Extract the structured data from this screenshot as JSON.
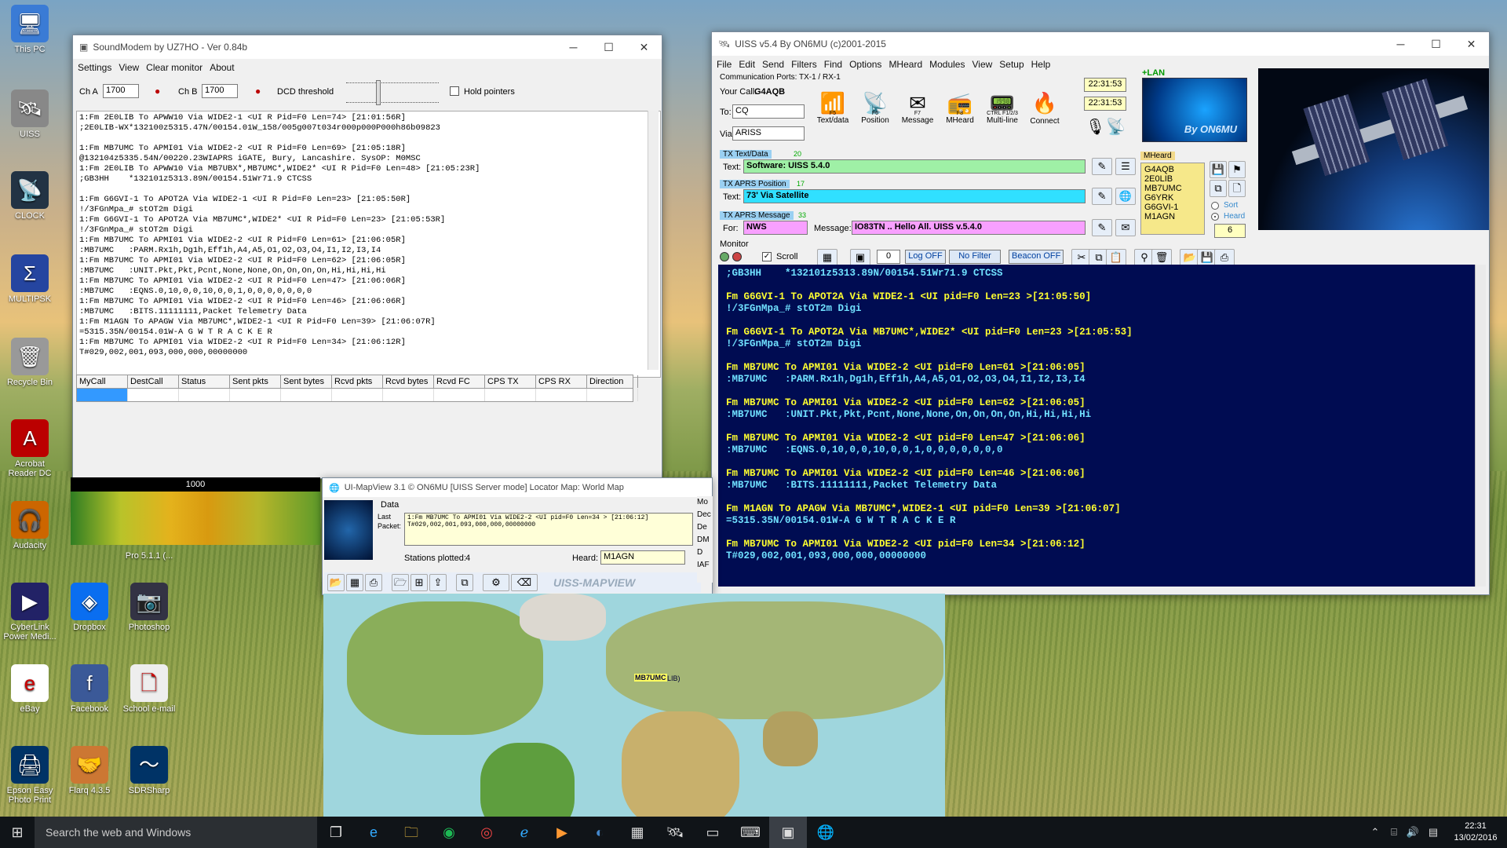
{
  "desktop": {
    "icons": [
      {
        "label": "This PC",
        "glyph": "🖥"
      },
      {
        "label": "UISS",
        "glyph": "🛰"
      },
      {
        "label": "CLOCK",
        "glyph": "📡"
      },
      {
        "label": "MULTIPSK",
        "glyph": "Σ"
      },
      {
        "label": "Recycle Bin",
        "glyph": "🗑"
      },
      {
        "label": "Acrobat Reader DC",
        "glyph": "A"
      },
      {
        "label": "Audacity",
        "glyph": "🎧"
      },
      {
        "label": "CyberLink Power Medi...",
        "glyph": "▶"
      },
      {
        "label": "Dropbox",
        "glyph": "◈"
      },
      {
        "label": "Photoshop",
        "glyph": "📷"
      },
      {
        "label": "eBay",
        "glyph": "e"
      },
      {
        "label": "Facebook",
        "glyph": "f"
      },
      {
        "label": "School e-mail",
        "glyph": "🗋"
      },
      {
        "label": "Epson Easy Photo Print",
        "glyph": "🖨"
      },
      {
        "label": "Flarq 4.3.5",
        "glyph": "🤝"
      },
      {
        "label": "SDRSharp",
        "glyph": "〜"
      },
      {
        "label": "Pro 5.1.1 (...",
        "glyph": ""
      }
    ]
  },
  "soundmodem": {
    "title": "SoundModem by UZ7HO - Ver 0.84b",
    "menu": [
      "Settings",
      "View",
      "Clear monitor",
      "About"
    ],
    "cha_label": "Ch A",
    "cha_value": "1700",
    "chb_label": "Ch B",
    "chb_value": "1700",
    "dcd_label": "DCD threshold",
    "hold_label": "Hold pointers",
    "lines": [
      "1:Fm 2E0LIB To APWW10 Via WIDE2-1 <UI R Pid=F0 Len=74> [21:01:56R]",
      ";2E0LIB-WX*132100z5315.47N/00154.01W_158/005g007t034r000p000P000h86b09823",
      "",
      "1:Fm MB7UMC To APMI01 Via WIDE2-2 <UI R Pid=F0 Len=69> [21:05:18R]",
      "@132104z5335.54N/00220.23WIAPRS iGATE, Bury, Lancashire. SysOP: M0MSC",
      "1:Fm 2E0LIB To APWW10 Via MB7UBX*,MB7UMC*,WIDE2* <UI R Pid=F0 Len=48> [21:05:23R]",
      ";GB3HH    *132101z5313.89N/00154.51Wr71.9 CTCSS",
      "",
      "1:Fm G6GVI-1 To APOT2A Via WIDE2-1 <UI R Pid=F0 Len=23> [21:05:50R]",
      "!/3FGnMpa_# stOT2m Digi",
      "1:Fm G6GVI-1 To APOT2A Via MB7UMC*,WIDE2* <UI R Pid=F0 Len=23> [21:05:53R]",
      "!/3FGnMpa_# stOT2m Digi",
      "1:Fm MB7UMC To APMI01 Via WIDE2-2 <UI R Pid=F0 Len=61> [21:06:05R]",
      ":MB7UMC   :PARM.Rx1h,Dg1h,Eff1h,A4,A5,O1,O2,O3,O4,I1,I2,I3,I4",
      "1:Fm MB7UMC To APMI01 Via WIDE2-2 <UI R Pid=F0 Len=62> [21:06:05R]",
      ":MB7UMC   :UNIT.Pkt,Pkt,Pcnt,None,None,On,On,On,On,Hi,Hi,Hi,Hi",
      "1:Fm MB7UMC To APMI01 Via WIDE2-2 <UI R Pid=F0 Len=47> [21:06:06R]",
      ":MB7UMC   :EQNS.0,10,0,0,10,0,0,1,0,0,0,0,0,0,0",
      "1:Fm MB7UMC To APMI01 Via WIDE2-2 <UI R Pid=F0 Len=46> [21:06:06R]",
      ":MB7UMC   :BITS.11111111,Packet Telemetry Data",
      "1:Fm M1AGN To APAGW Via MB7UMC*,WIDE2-1 <UI R Pid=F0 Len=39> [21:06:07R]",
      "=5315.35N/00154.01W-A G W T R A C K E R",
      "1:Fm MB7UMC To APMI01 Via WIDE2-2 <UI R Pid=F0 Len=34> [21:06:12R]",
      "T#029,002,001,093,000,000,00000000"
    ],
    "columns": [
      "MyCall",
      "DestCall",
      "Status",
      "Sent pkts",
      "Sent bytes",
      "Rcvd pkts",
      "Rcvd bytes",
      "Rcvd FC",
      "CPS TX",
      "CPS RX",
      "Direction"
    ],
    "waterfall_label": "1000"
  },
  "uiss": {
    "title": "UISS v5.4 By ON6MU (c)2001-2015",
    "menu": [
      "File",
      "Edit",
      "Send",
      "Filters",
      "Find",
      "Options",
      "MHeard",
      "Modules",
      "View",
      "Setup",
      "Help"
    ],
    "comm_ports": "Communication Ports: TX-1 / RX-1",
    "your_call_label": "Your Call:",
    "your_call": "G4AQB",
    "to_label": "To:",
    "to_value": "CQ",
    "via_label": "Via:",
    "via_value": "ARISS",
    "buttons": [
      {
        "key": "F5",
        "label": "Text/data"
      },
      {
        "key": "F6",
        "label": "Position"
      },
      {
        "key": "F7",
        "label": "Message"
      },
      {
        "key": "F8",
        "label": "MHeard"
      },
      {
        "key": "CTRL F1/2/3",
        "label": "Multi-line"
      },
      {
        "key": "",
        "label": "Connect"
      }
    ],
    "clock1": "22:31:53",
    "clock2": "22:31:53",
    "lan": "+LAN",
    "logo": "By ON6MU",
    "tx_text_hdr": "TX Text/Data",
    "tx_text_num": "20",
    "text_label": "Text:",
    "text_value": "Software: UISS 5.4.0",
    "tx_pos_hdr": "TX APRS Position",
    "tx_pos_num": "17",
    "pos_value": "73' Via Satellite",
    "tx_msg_hdr": "TX APRS Message",
    "tx_msg_num": "33",
    "for_label": "For:",
    "for_value": "NWS",
    "msg_label": "Message:",
    "msg_value": "IO83TN .. Hello All. UISS v.5.4.0",
    "mheard_hdr": "MHeard",
    "mheard": [
      "G4AQB",
      "2E0LIB",
      "MB7UMC",
      "G6YRK",
      "G6GVI-1",
      "M1AGN"
    ],
    "sort_label": "Sort",
    "heard_label": "Heard",
    "mheard_count": "6",
    "monitor_label": "Monitor",
    "scroll_label": "Scroll",
    "counter": "0",
    "log_btn": "Log OFF",
    "filter_btn": "No Filter",
    "beacon_btn": "Beacon OFF",
    "monitor_lines": [
      {
        "t": ";GB3HH    *132101z5313.89N/00154.51Wr71.9 CTCSS",
        "c": "c"
      },
      {
        "t": "",
        "c": "y"
      },
      {
        "t": "Fm G6GVI-1 To APOT2A Via WIDE2-1 <UI pid=F0 Len=23 >[21:05:50]",
        "c": "y"
      },
      {
        "t": "!/3FGnMpa_# stOT2m Digi",
        "c": "c"
      },
      {
        "t": "",
        "c": "y"
      },
      {
        "t": "Fm G6GVI-1 To APOT2A Via MB7UMC*,WIDE2* <UI pid=F0 Len=23 >[21:05:53]",
        "c": "y"
      },
      {
        "t": "!/3FGnMpa_# stOT2m Digi",
        "c": "c"
      },
      {
        "t": "",
        "c": "y"
      },
      {
        "t": "Fm MB7UMC To APMI01 Via WIDE2-2 <UI pid=F0 Len=61 >[21:06:05]",
        "c": "y"
      },
      {
        "t": ":MB7UMC   :PARM.Rx1h,Dg1h,Eff1h,A4,A5,O1,O2,O3,O4,I1,I2,I3,I4",
        "c": "c"
      },
      {
        "t": "",
        "c": "y"
      },
      {
        "t": "Fm MB7UMC To APMI01 Via WIDE2-2 <UI pid=F0 Len=62 >[21:06:05]",
        "c": "y"
      },
      {
        "t": ":MB7UMC   :UNIT.Pkt,Pkt,Pcnt,None,None,On,On,On,On,Hi,Hi,Hi,Hi",
        "c": "c"
      },
      {
        "t": "",
        "c": "y"
      },
      {
        "t": "Fm MB7UMC To APMI01 Via WIDE2-2 <UI pid=F0 Len=47 >[21:06:06]",
        "c": "y"
      },
      {
        "t": ":MB7UMC   :EQNS.0,10,0,0,10,0,0,1,0,0,0,0,0,0,0",
        "c": "c"
      },
      {
        "t": "",
        "c": "y"
      },
      {
        "t": "Fm MB7UMC To APMI01 Via WIDE2-2 <UI pid=F0 Len=46 >[21:06:06]",
        "c": "y"
      },
      {
        "t": ":MB7UMC   :BITS.11111111,Packet Telemetry Data",
        "c": "c"
      },
      {
        "t": "",
        "c": "y"
      },
      {
        "t": "Fm M1AGN To APAGW Via MB7UMC*,WIDE2-1 <UI pid=F0 Len=39 >[21:06:07]",
        "c": "y"
      },
      {
        "t": "=5315.35N/00154.01W-A G W T R A C K E R",
        "c": "c"
      },
      {
        "t": "",
        "c": "y"
      },
      {
        "t": "Fm MB7UMC To APMI01 Via WIDE2-2 <UI pid=F0 Len=34 >[21:06:12]",
        "c": "y"
      },
      {
        "t": "T#029,002,001,093,000,000,00000000",
        "c": "c"
      }
    ]
  },
  "mapview": {
    "title": "UI-MapView 3.1 © ON6MU  [UISS Server mode]  Locator Map: World Map",
    "data_label": "Data",
    "last_label": "Last",
    "packet_label": "Packet:",
    "packet_text": "1:Fm MB7UMC To APMI01 Via WIDE2-2 <UI pid=F0 Len=34 > [21:06:12]\nT#029,002,001,093,000,000,00000000",
    "stations_label": "Stations plotted:",
    "stations_value": "4",
    "heard_label": "Heard:",
    "heard_value": "M1AGN",
    "brand": "UISS-MAPVIEW",
    "map_label": "MB7UMC",
    "map_label2": "LIB)",
    "side_labels": [
      "Mo",
      "Dec",
      "De",
      "DM",
      "D",
      "IAF"
    ]
  },
  "taskbar": {
    "search": "Search the web and Windows",
    "time": "22:31",
    "date": "13/02/2016"
  }
}
